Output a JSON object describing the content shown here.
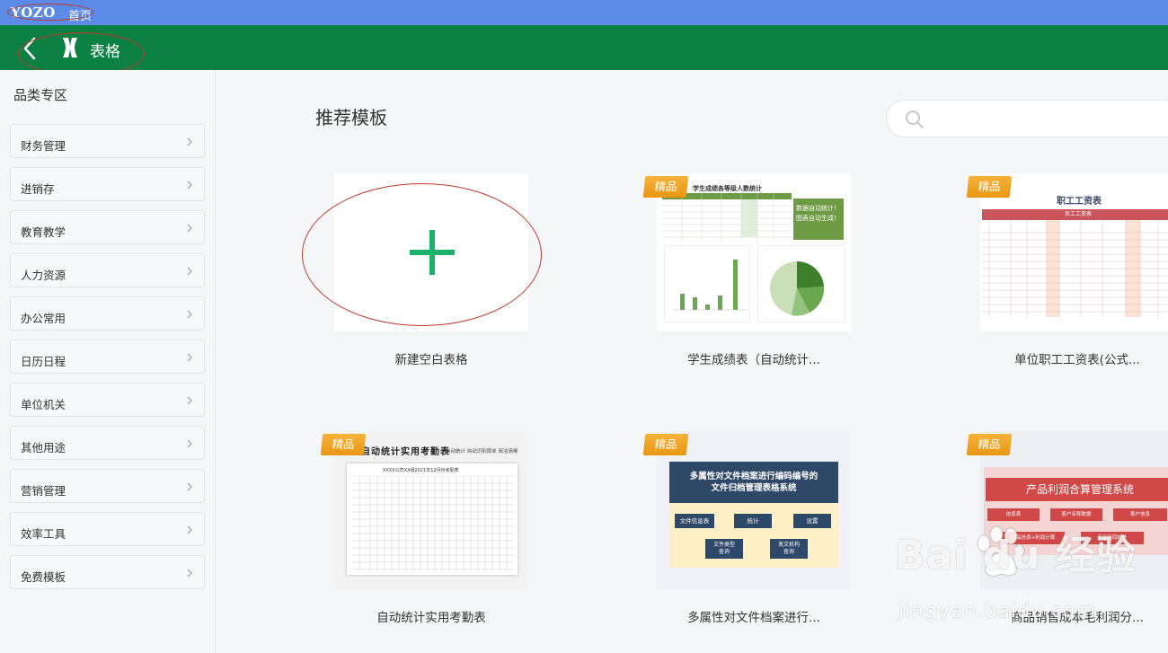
{
  "topbar": {
    "logo": "YOZO",
    "home": "首页"
  },
  "titlebar": {
    "title": "表格"
  },
  "sidebar": {
    "heading": "品类专区",
    "items": [
      {
        "label": "财务管理"
      },
      {
        "label": "进销存"
      },
      {
        "label": "教育教学"
      },
      {
        "label": "人力资源"
      },
      {
        "label": "办公常用"
      },
      {
        "label": "日历日程"
      },
      {
        "label": "单位机关"
      },
      {
        "label": "其他用途"
      },
      {
        "label": "营销管理"
      },
      {
        "label": "效率工具"
      },
      {
        "label": "免费模板"
      }
    ]
  },
  "main": {
    "section_title": "推荐模板",
    "search": {
      "placeholder": ""
    },
    "badge_label": "精品",
    "cards": [
      {
        "label": "新建空白表格"
      },
      {
        "label": "学生成绩表（自动统计..."
      },
      {
        "label": "单位职工工资表(公式..."
      },
      {
        "label": "自动统计实用考勤表"
      },
      {
        "label": "多属性对文件档案进行..."
      },
      {
        "label": "商品销售成本毛利润分..."
      }
    ],
    "thumbs": {
      "grades": {
        "title": "学生成绩各等级人数统计",
        "note1": "数据自动统计！",
        "note2": "图表自动生成！"
      },
      "payroll": {
        "title": "职工工资表",
        "subtitle": "员工工资表"
      },
      "attendance": {
        "title": "自动统计实用考勤表",
        "meta": "自动统计  自动识别周末  简洁清晰",
        "subtitle": "XXXX公司XX组2021年12月份考勤表"
      },
      "archive": {
        "title": "多属性对文件档案进行编码编号的文件归档管理表格系统",
        "b1": "文件信息表",
        "b2": "统计",
        "b3": "设置",
        "b4": "文件类型查询",
        "b5": "发文机构查询"
      },
      "profit": {
        "title": "产品利润合算管理系统",
        "b1": "信息表",
        "b2": "客户名称数据",
        "b3": "客户信息",
        "b4": "产品信息+利润计算",
        "b5": "产品利润统计"
      }
    }
  },
  "watermark": {
    "brand": "Bai  du 经验",
    "url": "jingyan.baidu.com"
  },
  "colors": {
    "topbar": "#5b8be6",
    "titlebar": "#0c8043",
    "accent_plus": "#1db26b",
    "badge": "#f0a526"
  }
}
